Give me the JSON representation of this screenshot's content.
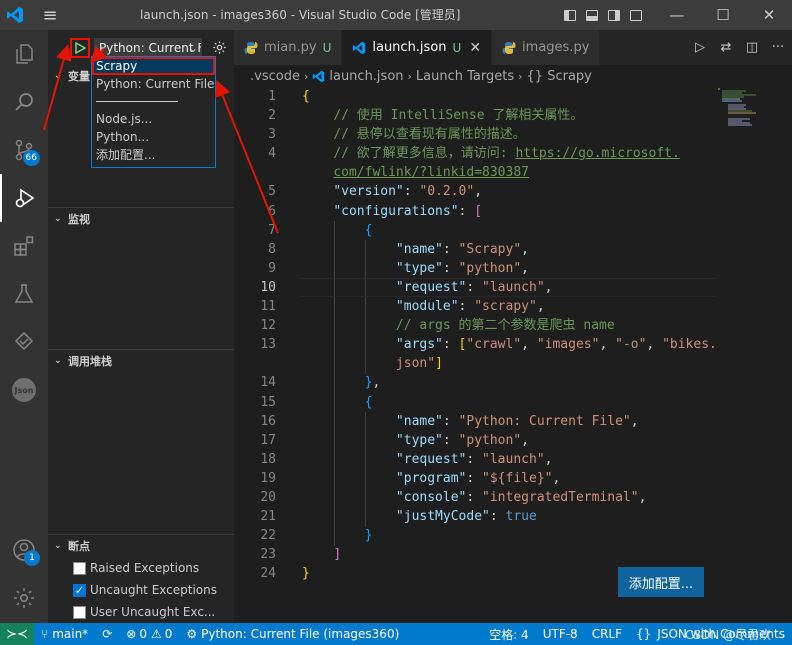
{
  "window": {
    "title": "launch.json - images360 - Visual Studio Code [管理员]",
    "minimize": "—",
    "maximize": "☐",
    "close": "✕"
  },
  "activity_bar": {
    "scm_badge": "66",
    "accounts_badge": "1",
    "json_label": "Json"
  },
  "debug": {
    "config_value": "Python: Current File",
    "dropdown_items": [
      "Scrapy",
      "Python: Current File",
      "Node.js...",
      "Python...",
      "添加配置..."
    ],
    "selected_item": "Scrapy"
  },
  "sidebar": {
    "variables_title": "变量",
    "watch_title": "监视",
    "callstack_title": "调用堆栈",
    "breakpoints_title": "断点",
    "breakpoints": [
      {
        "label": "Raised Exceptions",
        "checked": false
      },
      {
        "label": "Uncaught Exceptions",
        "checked": true
      },
      {
        "label": "User Uncaught Exc...",
        "checked": false
      }
    ]
  },
  "tabs": [
    {
      "label": "mian.py",
      "status": "U",
      "active": false
    },
    {
      "label": "launch.json",
      "status": "U",
      "active": true
    },
    {
      "label": "images.py",
      "status": "",
      "active": false
    }
  ],
  "breadcrumb": [
    ".vscode",
    "launch.json",
    "Launch Targets",
    "{} Scrapy"
  ],
  "code_lines": [
    {
      "n": "1"
    },
    {
      "n": "2"
    },
    {
      "n": "3"
    },
    {
      "n": "4"
    },
    {
      "n": ""
    },
    {
      "n": "5"
    },
    {
      "n": "6"
    },
    {
      "n": "7"
    },
    {
      "n": "8"
    },
    {
      "n": "9"
    },
    {
      "n": "10"
    },
    {
      "n": "11"
    },
    {
      "n": "12"
    },
    {
      "n": "13"
    },
    {
      "n": ""
    },
    {
      "n": "14"
    },
    {
      "n": "15"
    },
    {
      "n": "16"
    },
    {
      "n": "17"
    },
    {
      "n": "18"
    },
    {
      "n": "19"
    },
    {
      "n": "20"
    },
    {
      "n": "21"
    },
    {
      "n": "22"
    },
    {
      "n": "23"
    },
    {
      "n": "24"
    }
  ],
  "code_text": {
    "c2": "// 使用 IntelliSense 了解相关属性。",
    "c3": "// 悬停以查看现有属性的描述。",
    "c4": "// 欲了解更多信息，请访问: ",
    "url1": "https://go.microsoft.",
    "url2": "com/fwlink/?linkid=830387",
    "version_key": "\"version\"",
    "version_val": "\"0.2.0\"",
    "configs_key": "\"configurations\"",
    "name_key": "\"name\"",
    "type_key": "\"type\"",
    "request_key": "\"request\"",
    "module_key": "\"module\"",
    "args_key": "\"args\"",
    "program_key": "\"program\"",
    "console_key": "\"console\"",
    "justmycode_key": "\"justMyCode\"",
    "scrapy_name": "\"Scrapy\"",
    "python_val": "\"python\"",
    "launch_val": "\"launch\"",
    "scrapy_mod": "\"scrapy\"",
    "args_comment": "// args 的第二个参数是爬虫 name",
    "arg1": "\"crawl\"",
    "arg2": "\"images\"",
    "arg3": "\"-o\"",
    "arg4a": "\"bikes.",
    "arg4b": "json\"",
    "pcf_name": "\"Python: Current File\"",
    "file_val": "\"${file}\"",
    "integrated_val": "\"integratedTerminal\"",
    "true_val": "true"
  },
  "add_config_button": "添加配置...",
  "status_bar": {
    "branch": "main*",
    "errors": "0",
    "warnings": "0",
    "debug_target": "Python: Current File (images360)",
    "spaces": "空格: 4",
    "encoding": "UTF-8",
    "eol": "CRLF",
    "language": "JSON with Comments",
    "watermark": "CSDN @尽君欢"
  },
  "colors": {
    "accent": "#007acc",
    "annotation": "#e51400"
  }
}
